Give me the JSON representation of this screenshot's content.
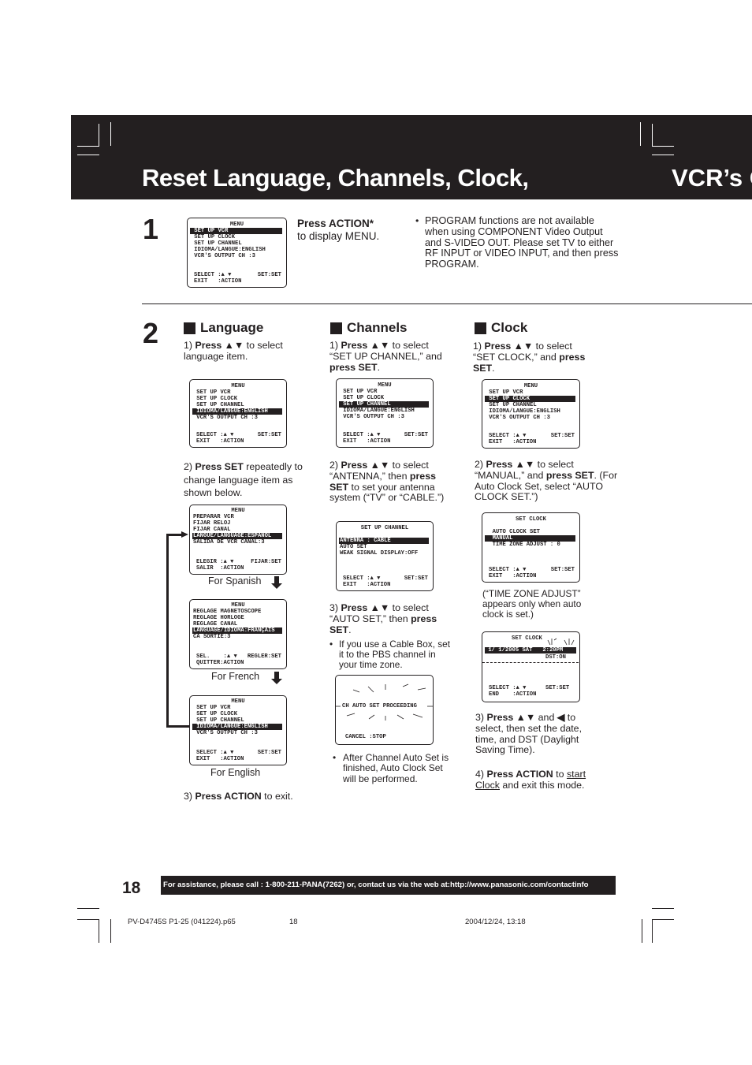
{
  "header": {
    "title": "Reset Language, Channels, Clock,",
    "title_continued": "VCR’s O"
  },
  "step1": {
    "number": "1",
    "osd": {
      "title": "MENU",
      "items": [
        "SET UP VCR",
        "SET UP CLOCK",
        "SET UP CHANNEL",
        "IDIOMA/LANGUE:ENGLISH",
        "VCR'S OUTPUT CH :3"
      ],
      "highlighted_index": 0,
      "footer1_left": "SELECT :▲ ▼",
      "footer1_right": "SET:SET",
      "footer2": "EXIT   :ACTION"
    },
    "instruction_bold": "Press ACTION*",
    "instruction_rest": "to display MENU.",
    "note": "PROGRAM functions are not available when using COMPONENT Video Output and S-VIDEO OUT. Please set TV to either RF INPUT or VIDEO INPUT, and then press PROGRAM."
  },
  "step2": {
    "number": "2",
    "language": {
      "heading": "Language",
      "s1_num": "1)",
      "s1_bold": "Press ▲▼",
      "s1_rest": " to select language item.",
      "osd": {
        "title": "MENU",
        "items": [
          "SET UP VCR",
          "SET UP CLOCK",
          "SET UP CHANNEL",
          "IDIOMA/LANGUE:ENGLISH",
          "VCR'S OUTPUT CH :3"
        ],
        "highlighted_index": 3,
        "footer1_left": "SELECT :▲ ▼",
        "footer1_right": "SET:SET",
        "footer2": "EXIT   :ACTION"
      },
      "s2_num": "2)",
      "s2_bold": "Press SET",
      "s2_rest": " repeatedly to change language item as shown below.",
      "osd_spanish": {
        "title": "MENU",
        "items": [
          "PREPARAR VCR",
          "FIJAR RELOJ",
          "FIJAR CANAL",
          "LANGUE/LANGUAGE:ESPAÑOL",
          "SALIDA DE VCR CANAL:3"
        ],
        "highlighted_index": 3,
        "footer1_left": "ELEGIR :▲ ▼",
        "footer1_right": "FIJAR:SET",
        "footer2": "SALIR  :ACTION"
      },
      "caption_spanish": "For Spanish",
      "osd_french": {
        "title": "MENU",
        "items": [
          "REGLAGE MAGNETOSCOPE",
          "REGLAGE HORLOGE",
          "REGLAGE CANAL",
          "LANGUAGE/IDIOMA:FRANÇAIS",
          "CA SORTIE:3"
        ],
        "highlighted_index": 3,
        "footer1_left": "SEL.    :▲ ▼",
        "footer1_right": "REGLER:SET",
        "footer2": "QUITTER:ACTION"
      },
      "caption_french": "For  French",
      "osd_english": {
        "title": "MENU",
        "items": [
          "SET UP VCR",
          "SET UP CLOCK",
          "SET UP CHANNEL",
          "IDIOMA/LANGUE:ENGLISH",
          "VCR'S OUTPUT CH :3"
        ],
        "highlighted_index": 3,
        "footer1_left": "SELECT :▲ ▼",
        "footer1_right": "SET:SET",
        "footer2": "EXIT   :ACTION"
      },
      "caption_english": "For English",
      "s3_num": "3)",
      "s3_bold": "Press ACTION",
      "s3_rest": " to exit."
    },
    "channels": {
      "heading": "Channels",
      "s1_num": "1)",
      "s1_bold": "Press ▲▼",
      "s1_rest": " to select “SET UP CHANNEL,” and ",
      "s1_bold2": "press SET",
      "s1_end": ".",
      "osd": {
        "title": "MENU",
        "items": [
          "SET UP VCR",
          "SET UP CLOCK",
          "SET UP CHANNEL",
          "IDIOMA/LANGUE:ENGLISH",
          "VCR'S OUTPUT CH :3"
        ],
        "highlighted_index": 2,
        "footer1_left": "SELECT :▲ ▼",
        "footer1_right": "SET:SET",
        "footer2": "EXIT   :ACTION"
      },
      "s2_num": "2)",
      "s2_bold": "Press ▲▼",
      "s2_rest": " to select “ANTENNA,” then ",
      "s2_bold2": "press SET",
      "s2_end": " to set your antenna system (“TV” or “CABLE.”)",
      "osd2": {
        "title": "SET UP CHANNEL",
        "items": [
          "ANTENNA : CABLE",
          "AUTO SET",
          "WEAK SIGNAL DISPLAY:OFF"
        ],
        "highlighted_index": 0,
        "footer1_left": "SELECT :▲ ▼",
        "footer1_right": "SET:SET",
        "footer2": "EXIT   :ACTION"
      },
      "s3_num": "3)",
      "s3_bold": "Press ▲▼",
      "s3_rest": " to select “AUTO SET,” then ",
      "s3_bold2": "press SET",
      "s3_end": ".",
      "bullet1": "If you use a Cable Box, set it to the PBS channel in your time zone.",
      "osd3": {
        "message": "CH AUTO SET PROCEEDING",
        "footer": "CANCEL :STOP"
      },
      "bullet2": "After Channel Auto Set is finished, Auto Clock Set will be performed."
    },
    "clock": {
      "heading": "Clock",
      "s1_num": "1)",
      "s1_bold": "Press ▲▼",
      "s1_rest": " to select “SET CLOCK,” and ",
      "s1_bold2": "press SET",
      "s1_end": ".",
      "osd": {
        "title": "MENU",
        "items": [
          "SET UP VCR",
          "SET UP CLOCK",
          "SET UP CHANNEL",
          "IDIOMA/LANGUE:ENGLISH",
          "VCR'S OUTPUT CH :3"
        ],
        "highlighted_index": 1,
        "footer1_left": "SELECT :▲ ▼",
        "footer1_right": "SET:SET",
        "footer2": "EXIT   :ACTION"
      },
      "s2_num": "2)",
      "s2_bold": "Press ▲▼",
      "s2_rest": " to select “MANUAL,” and ",
      "s2_bold2": "press SET",
      "s2_end": ". (For Auto Clock Set, select “AUTO CLOCK SET.”)",
      "osd2": {
        "title": "SET CLOCK",
        "items": [
          "AUTO CLOCK SET",
          "MANUAL",
          "TIME ZONE ADJUST : 0"
        ],
        "highlighted_index": 1,
        "footer1_left": "SELECT :▲ ▼",
        "footer1_right": "SET:SET",
        "footer2": "EXIT   :ACTION"
      },
      "note": "(“TIME ZONE ADJUST” appears only when auto clock is set.)",
      "osd3": {
        "title": "SET CLOCK",
        "datetime": " 1/ 1/2005 SAT   2:20PM",
        "dst": "DST:ON",
        "footer1_left": "SELECT :▲ ▼",
        "footer1_right": "SET:SET",
        "footer2": "END    :ACTION"
      },
      "s3_num": "3)",
      "s3_bold": "Press ▲▼",
      "s3_mid": " and ",
      "s3_bold2": "◀",
      "s3_rest": " to select, then set the date, time, and DST (Daylight Saving Time).",
      "s4_num": "4)",
      "s4_bold": "Press ACTION",
      "s4_mid": " to ",
      "s4_u1": "start",
      "s4_u2": "Clock",
      "s4_rest": " and exit this mode."
    }
  },
  "footer": {
    "page_number": "18",
    "assistance": "For assistance, please call : 1-800-211-PANA(7262) or, contact us via the web at:http://www.panasonic.com/contactinfo",
    "file_name": "PV-D4745S P1-25 (041224).p65",
    "file_page": "18",
    "timestamp": "2004/12/24, 13:18"
  }
}
